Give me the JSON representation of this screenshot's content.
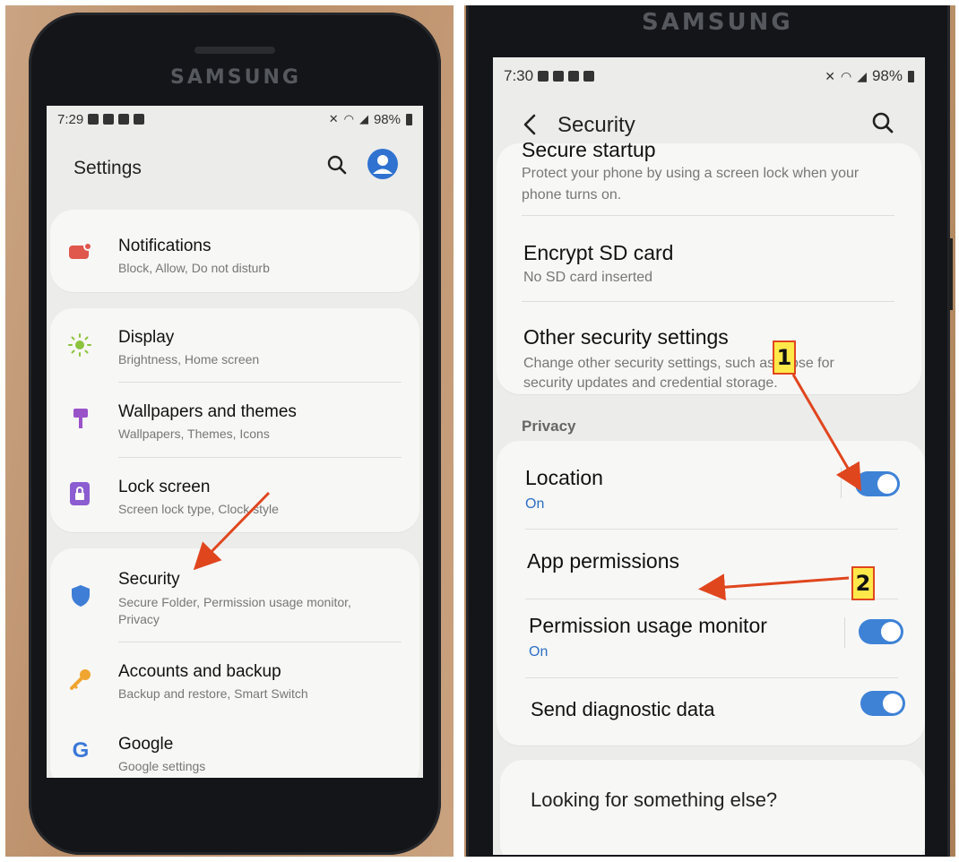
{
  "left_phone": {
    "brand": "SAMSUNG",
    "status": {
      "time": "7:29",
      "battery": "98%"
    },
    "header": {
      "title": "Settings"
    },
    "items": [
      {
        "title": "Notifications",
        "subtitle": "Block, Allow, Do not disturb",
        "icon": "notifications-icon"
      },
      {
        "title": "Display",
        "subtitle": "Brightness, Home screen",
        "icon": "sun-icon"
      },
      {
        "title": "Wallpapers and themes",
        "subtitle": "Wallpapers, Themes, Icons",
        "icon": "paintbrush-icon"
      },
      {
        "title": "Lock screen",
        "subtitle": "Screen lock type, Clock style",
        "icon": "lock-icon"
      },
      {
        "title": "Security",
        "subtitle": "Secure Folder, Permission usage monitor, Privacy",
        "icon": "shield-icon"
      },
      {
        "title": "Accounts and backup",
        "subtitle": "Backup and restore, Smart Switch",
        "icon": "key-icon"
      },
      {
        "title": "Google",
        "subtitle": "Google settings",
        "icon": "google-icon"
      }
    ]
  },
  "right_phone": {
    "brand": "SAMSUNG",
    "status": {
      "time": "7:30",
      "battery": "98%"
    },
    "header": {
      "title": "Security"
    },
    "items": [
      {
        "title": "Secure startup",
        "subtitle": "Protect your phone by using a screen lock when your phone turns on."
      },
      {
        "title": "Encrypt SD card",
        "subtitle": "No SD card inserted"
      },
      {
        "title": "Other security settings",
        "subtitle": "Change other security settings, such as those for security updates and credential storage."
      }
    ],
    "privacy": {
      "section_label": "Privacy",
      "location": {
        "title": "Location",
        "status": "On",
        "toggle_on": true
      },
      "app_permissions": {
        "title": "App permissions"
      },
      "permission_monitor": {
        "title": "Permission usage monitor",
        "status": "On",
        "toggle_on": true
      },
      "diagnostic": {
        "title": "Send diagnostic data",
        "toggle_on": true
      }
    },
    "footer_card": {
      "title": "Looking for something else?"
    }
  },
  "annotations": {
    "label_1": "1",
    "label_2": "2",
    "arrow_color": "#e0461e"
  },
  "colors": {
    "accent": "#3e82d6",
    "status_on": "#2c6fc4"
  }
}
